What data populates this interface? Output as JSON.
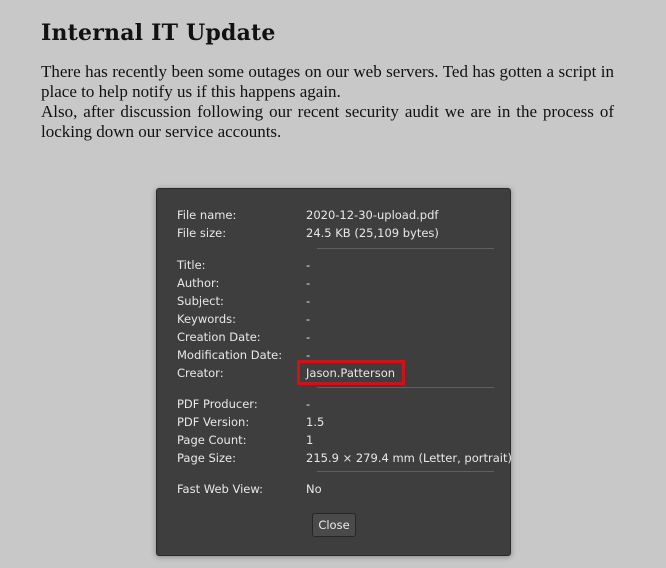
{
  "document": {
    "title": "Internal IT Update",
    "paragraph1": "There has recently been some outages on our web servers.  Ted has gotten a script in place to help notify us if this happens again.",
    "paragraph2": "Also, after discussion following our recent security audit we are in the process of locking down our service accounts."
  },
  "dialog": {
    "file_info": [
      {
        "label": "File name:",
        "value": "2020-12-30-upload.pdf"
      },
      {
        "label": "File size:",
        "value": "24.5 KB (25,109 bytes)"
      }
    ],
    "metadata": [
      {
        "label": "Title:",
        "value": "-"
      },
      {
        "label": "Author:",
        "value": "-"
      },
      {
        "label": "Subject:",
        "value": "-"
      },
      {
        "label": "Keywords:",
        "value": "-"
      },
      {
        "label": "Creation Date:",
        "value": "-"
      },
      {
        "label": "Modification Date:",
        "value": "-"
      },
      {
        "label": "Creator:",
        "value": "Jason.Patterson"
      }
    ],
    "pdf_info": [
      {
        "label": "PDF Producer:",
        "value": "-"
      },
      {
        "label": "PDF Version:",
        "value": "1.5"
      },
      {
        "label": "Page Count:",
        "value": "1"
      },
      {
        "label": "Page Size:",
        "value": "215.9 × 279.4 mm (Letter, portrait)"
      }
    ],
    "web_view": [
      {
        "label": "Fast Web View:",
        "value": "No"
      }
    ],
    "close_label": "Close",
    "highlight_color": "#d0101a"
  }
}
